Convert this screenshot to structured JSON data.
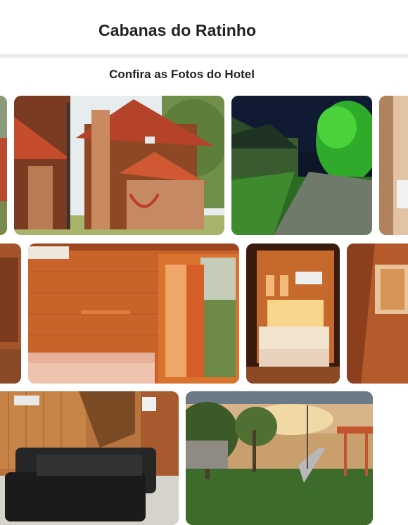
{
  "header": {
    "title": "Cabanas do Ratinho"
  },
  "gallery": {
    "title": "Confira as Fotos do Hotel",
    "photos": [
      {
        "subject": "wooden chalet exterior with red tile roof, brick chimney and hammock"
      },
      {
        "subject": "paved path between chalets at night lit by green lights"
      },
      {
        "subject": "bedroom with wooden walls, window and door open to field"
      },
      {
        "subject": "bedroom with bed and air conditioner under warm lighting"
      },
      {
        "subject": "living room with black leather sofa and staircase"
      },
      {
        "subject": "garden with trees, playground and slide at sunset"
      }
    ]
  }
}
